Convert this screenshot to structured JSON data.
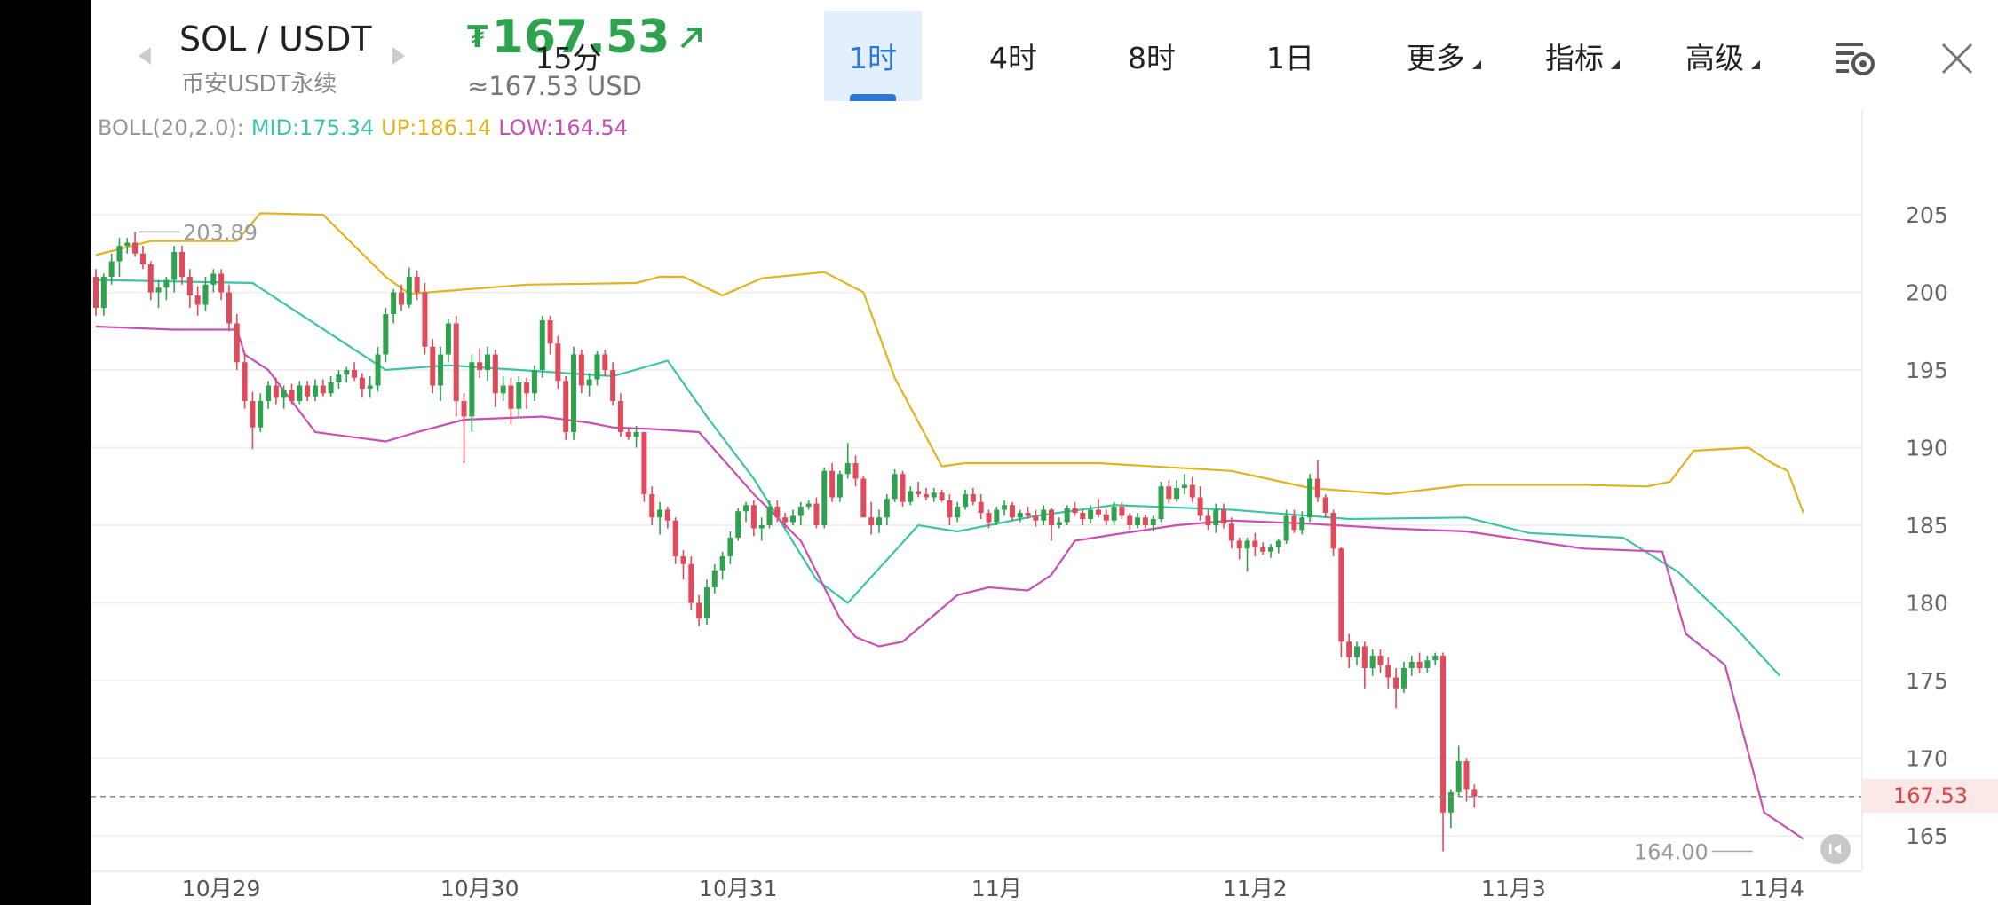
{
  "header": {
    "symbol": "SOL / USDT",
    "market": "币安USDT永续",
    "price": "167.53",
    "currency_symbol": "₮",
    "approx": "≈167.53 USD",
    "intervals": [
      {
        "label": "15分"
      },
      {
        "label": "1时"
      },
      {
        "label": "4时"
      },
      {
        "label": "8时"
      },
      {
        "label": "1日"
      }
    ],
    "active_interval": "1时",
    "menus": [
      {
        "label": "更多"
      },
      {
        "label": "指标"
      },
      {
        "label": "高级"
      }
    ],
    "settings_icon": "chart-settings-icon",
    "close_icon": "close-icon"
  },
  "indicator": {
    "name": "BOLL(20,2.0):",
    "mid": "MID:175.34",
    "up": "UP:186.14",
    "low": "LOW:164.54"
  },
  "colors": {
    "up": "#2ea24e",
    "down": "#e04a5a",
    "mid": "#3cc4a4",
    "upper": "#e0b420",
    "lower": "#c84fb4",
    "accent": "#2a78dc"
  },
  "chart_data": {
    "type": "candlestick",
    "ylim": [
      162,
      209
    ],
    "yticks": [
      205,
      200,
      195,
      190,
      185,
      180,
      175,
      170,
      165
    ],
    "x_labels": [
      {
        "label": "10月29",
        "index": 16
      },
      {
        "label": "10月30",
        "index": 49
      },
      {
        "label": "10月31",
        "index": 82
      },
      {
        "label": "11月",
        "index": 115
      },
      {
        "label": "11月2",
        "index": 148
      },
      {
        "label": "11月3",
        "index": 181
      },
      {
        "label": "11月4",
        "index": 214
      }
    ],
    "last_price": 167.53,
    "last_price_label": "167.53",
    "max_label": "203.89",
    "max_value": 203.89,
    "max_index": 5,
    "min_label": "164.00",
    "min_value": 164.0,
    "min_index": 212,
    "boll_mid": [
      [
        0,
        200.8
      ],
      [
        20,
        200.6
      ],
      [
        37,
        195.0
      ],
      [
        45,
        195.3
      ],
      [
        66,
        194.6
      ],
      [
        73,
        195.6
      ],
      [
        78,
        192.0
      ],
      [
        84,
        188.0
      ],
      [
        92,
        181.5
      ],
      [
        96,
        180.0
      ],
      [
        105,
        185.0
      ],
      [
        110,
        184.6
      ],
      [
        120,
        185.6
      ],
      [
        130,
        186.3
      ],
      [
        145,
        186.0
      ],
      [
        160,
        185.4
      ],
      [
        175,
        185.5
      ],
      [
        183,
        184.5
      ],
      [
        195,
        184.2
      ],
      [
        202,
        182.0
      ],
      [
        209,
        178.6
      ],
      [
        215,
        175.3
      ]
    ],
    "boll_upper": [
      [
        0,
        202.4
      ],
      [
        7,
        203.3
      ],
      [
        18,
        203.3
      ],
      [
        21,
        205.1
      ],
      [
        29,
        205.0
      ],
      [
        37,
        201.0
      ],
      [
        40,
        199.9
      ],
      [
        55,
        200.5
      ],
      [
        69,
        200.6
      ],
      [
        72,
        201.0
      ],
      [
        75,
        201.0
      ],
      [
        80,
        199.8
      ],
      [
        85,
        200.9
      ],
      [
        93,
        201.3
      ],
      [
        98,
        200.0
      ],
      [
        102,
        194.5
      ],
      [
        108,
        188.8
      ],
      [
        111,
        189.0
      ],
      [
        128,
        189.0
      ],
      [
        145,
        188.5
      ],
      [
        155,
        187.4
      ],
      [
        165,
        187.0
      ],
      [
        175,
        187.6
      ],
      [
        190,
        187.6
      ],
      [
        198,
        187.5
      ],
      [
        201,
        187.8
      ],
      [
        204,
        189.8
      ],
      [
        211,
        190.0
      ],
      [
        214,
        189.0
      ],
      [
        216,
        188.5
      ],
      [
        218,
        185.8
      ]
    ],
    "boll_lower": [
      [
        0,
        197.8
      ],
      [
        10,
        197.6
      ],
      [
        18,
        197.6
      ],
      [
        19,
        196.0
      ],
      [
        22,
        195.0
      ],
      [
        28,
        191.0
      ],
      [
        37,
        190.4
      ],
      [
        41,
        191.0
      ],
      [
        47,
        191.8
      ],
      [
        57,
        192.0
      ],
      [
        63,
        191.6
      ],
      [
        66,
        191.3
      ],
      [
        71,
        191.2
      ],
      [
        77,
        191.0
      ],
      [
        84,
        187.0
      ],
      [
        90,
        184.0
      ],
      [
        95,
        179.0
      ],
      [
        97,
        177.8
      ],
      [
        100,
        177.2
      ],
      [
        103,
        177.5
      ],
      [
        110,
        180.5
      ],
      [
        114,
        181.0
      ],
      [
        119,
        180.8
      ],
      [
        122,
        181.8
      ],
      [
        125,
        184.0
      ],
      [
        130,
        184.4
      ],
      [
        138,
        185.0
      ],
      [
        145,
        185.3
      ],
      [
        155,
        185.1
      ],
      [
        165,
        184.8
      ],
      [
        175,
        184.6
      ],
      [
        190,
        183.5
      ],
      [
        200,
        183.3
      ],
      [
        203,
        178.0
      ],
      [
        208,
        176.0
      ],
      [
        213,
        166.5
      ],
      [
        218,
        164.8
      ]
    ],
    "candles": [
      [
        201.0,
        201.5,
        198.5,
        199.0
      ],
      [
        199.0,
        201.2,
        198.5,
        201.0
      ],
      [
        201.0,
        202.5,
        200.5,
        202.0
      ],
      [
        202.0,
        203.5,
        201.0,
        203.0
      ],
      [
        203.0,
        203.5,
        202.5,
        203.2
      ],
      [
        203.2,
        203.89,
        202.3,
        202.5
      ],
      [
        202.5,
        203.0,
        201.5,
        201.8
      ],
      [
        201.8,
        202.0,
        199.5,
        200.0
      ],
      [
        200.0,
        200.8,
        199.0,
        200.3
      ],
      [
        200.3,
        201.0,
        199.5,
        200.8
      ],
      [
        200.8,
        203.0,
        200.0,
        202.6
      ],
      [
        202.6,
        203.0,
        200.5,
        201.0
      ],
      [
        201.0,
        201.5,
        199.0,
        199.8
      ],
      [
        199.8,
        200.4,
        198.5,
        199.2
      ],
      [
        199.2,
        201.0,
        198.8,
        200.5
      ],
      [
        200.5,
        201.5,
        200.0,
        201.2
      ],
      [
        201.2,
        201.5,
        199.5,
        200.0
      ],
      [
        200.0,
        200.5,
        197.5,
        198.0
      ],
      [
        198.0,
        198.6,
        195.0,
        195.5
      ],
      [
        195.5,
        196.0,
        192.5,
        193.0
      ],
      [
        193.0,
        193.6,
        189.9,
        191.3
      ],
      [
        191.3,
        193.5,
        191.0,
        193.0
      ],
      [
        193.0,
        194.3,
        192.5,
        194.0
      ],
      [
        194.0,
        194.5,
        192.8,
        193.2
      ],
      [
        193.2,
        194.0,
        192.5,
        193.7
      ],
      [
        193.7,
        194.1,
        192.8,
        193.0
      ],
      [
        193.0,
        194.3,
        192.8,
        194.0
      ],
      [
        194.0,
        194.3,
        193.0,
        193.3
      ],
      [
        193.3,
        194.4,
        193.0,
        194.0
      ],
      [
        194.0,
        194.4,
        193.3,
        193.5
      ],
      [
        193.5,
        194.6,
        193.3,
        194.2
      ],
      [
        194.2,
        195.0,
        193.8,
        194.7
      ],
      [
        194.7,
        195.2,
        194.2,
        195.0
      ],
      [
        195.0,
        195.5,
        194.3,
        194.5
      ],
      [
        194.5,
        194.8,
        193.2,
        193.8
      ],
      [
        193.8,
        194.6,
        193.2,
        194.0
      ],
      [
        194.0,
        196.5,
        193.6,
        196.0
      ],
      [
        196.0,
        199.0,
        195.5,
        198.6
      ],
      [
        198.6,
        200.2,
        198.0,
        200.0
      ],
      [
        200.0,
        200.5,
        198.8,
        199.2
      ],
      [
        199.2,
        201.6,
        199.0,
        201.0
      ],
      [
        201.0,
        201.4,
        199.5,
        200.0
      ],
      [
        200.0,
        200.6,
        196.0,
        196.5
      ],
      [
        196.5,
        197.0,
        193.5,
        194.0
      ],
      [
        194.0,
        196.5,
        193.0,
        196.0
      ],
      [
        196.0,
        198.3,
        195.5,
        198.0
      ],
      [
        198.0,
        198.5,
        192.0,
        193.0
      ],
      [
        193.0,
        193.5,
        189.0,
        192.0
      ],
      [
        192.0,
        196.0,
        191.0,
        195.5
      ],
      [
        195.5,
        196.4,
        194.5,
        195.0
      ],
      [
        195.0,
        196.5,
        194.3,
        196.0
      ],
      [
        196.0,
        196.3,
        192.6,
        193.5
      ],
      [
        193.5,
        194.6,
        193.0,
        194.0
      ],
      [
        194.0,
        194.5,
        191.5,
        192.5
      ],
      [
        192.5,
        194.6,
        192.0,
        194.2
      ],
      [
        194.2,
        194.5,
        192.5,
        193.5
      ],
      [
        193.5,
        195.3,
        193.0,
        195.0
      ],
      [
        195.0,
        198.5,
        194.5,
        198.2
      ],
      [
        198.2,
        198.5,
        196.0,
        196.7
      ],
      [
        196.7,
        197.2,
        193.8,
        194.3
      ],
      [
        194.3,
        194.6,
        190.5,
        191.0
      ],
      [
        191.0,
        196.5,
        190.5,
        196.0
      ],
      [
        196.0,
        196.3,
        193.5,
        194.0
      ],
      [
        194.0,
        194.8,
        193.3,
        194.4
      ],
      [
        194.4,
        196.2,
        194.0,
        196.0
      ],
      [
        196.0,
        196.3,
        194.6,
        195.0
      ],
      [
        195.0,
        195.5,
        192.7,
        193.0
      ],
      [
        193.0,
        193.5,
        190.7,
        191.0
      ],
      [
        191.0,
        191.2,
        190.5,
        190.7
      ],
      [
        190.7,
        191.4,
        190.0,
        191.0
      ],
      [
        191.0,
        191.0,
        186.5,
        187.0
      ],
      [
        187.0,
        187.5,
        185.0,
        185.5
      ],
      [
        185.5,
        186.5,
        184.4,
        186.0
      ],
      [
        186.0,
        186.2,
        184.8,
        185.3
      ],
      [
        185.3,
        185.5,
        182.5,
        183.0
      ],
      [
        183.0,
        183.4,
        181.5,
        182.5
      ],
      [
        182.5,
        183.0,
        179.5,
        180.0
      ],
      [
        180.0,
        180.5,
        178.5,
        179.0
      ],
      [
        179.0,
        181.5,
        178.6,
        181.0
      ],
      [
        181.0,
        182.5,
        180.6,
        182.1
      ],
      [
        182.1,
        183.3,
        181.5,
        183.0
      ],
      [
        183.0,
        184.6,
        182.5,
        184.2
      ],
      [
        184.2,
        186.1,
        184.0,
        185.9
      ],
      [
        185.9,
        186.5,
        185.2,
        186.3
      ],
      [
        186.3,
        186.6,
        184.3,
        184.8
      ],
      [
        184.8,
        185.5,
        184.0,
        185.0
      ],
      [
        185.0,
        186.6,
        184.8,
        186.2
      ],
      [
        186.2,
        186.6,
        185.2,
        185.5
      ],
      [
        185.5,
        185.8,
        184.8,
        185.2
      ],
      [
        185.2,
        186.0,
        185.0,
        185.6
      ],
      [
        185.6,
        186.5,
        185.0,
        186.2
      ],
      [
        186.2,
        186.6,
        186.0,
        186.4
      ],
      [
        186.4,
        186.8,
        184.8,
        185.0
      ],
      [
        185.0,
        188.7,
        184.8,
        188.5
      ],
      [
        188.5,
        189.0,
        186.5,
        186.8
      ],
      [
        186.8,
        188.5,
        186.5,
        188.3
      ],
      [
        188.3,
        190.3,
        188.0,
        189.0
      ],
      [
        189.0,
        189.5,
        187.5,
        188.0
      ],
      [
        188.0,
        188.2,
        185.5,
        185.5
      ],
      [
        185.5,
        186.5,
        184.4,
        185.0
      ],
      [
        185.0,
        186.0,
        184.5,
        185.5
      ],
      [
        185.5,
        187.0,
        185.0,
        186.7
      ],
      [
        186.7,
        188.6,
        186.5,
        188.3
      ],
      [
        188.3,
        188.5,
        186.2,
        186.5
      ],
      [
        186.5,
        187.5,
        186.3,
        187.2
      ],
      [
        187.2,
        187.8,
        186.8,
        187.0
      ],
      [
        187.0,
        187.4,
        186.6,
        186.8
      ],
      [
        186.8,
        187.4,
        186.5,
        187.1
      ],
      [
        187.1,
        187.3,
        186.5,
        186.6
      ],
      [
        186.6,
        187.0,
        185.0,
        185.5
      ],
      [
        185.5,
        186.5,
        185.2,
        186.2
      ],
      [
        186.2,
        187.3,
        186.0,
        187.0
      ],
      [
        187.0,
        187.4,
        186.3,
        186.5
      ],
      [
        186.5,
        187.0,
        185.4,
        185.8
      ],
      [
        185.8,
        186.0,
        184.8,
        185.2
      ],
      [
        185.2,
        186.2,
        185.0,
        186.0
      ],
      [
        186.0,
        186.6,
        185.6,
        186.3
      ],
      [
        186.3,
        186.5,
        185.3,
        185.5
      ],
      [
        185.5,
        186.0,
        185.2,
        185.8
      ],
      [
        185.8,
        186.2,
        185.4,
        185.6
      ],
      [
        185.6,
        186.0,
        184.9,
        185.3
      ],
      [
        185.3,
        186.3,
        185.0,
        186.0
      ],
      [
        186.0,
        186.1,
        184.0,
        185.0
      ],
      [
        185.0,
        185.5,
        184.8,
        185.2
      ],
      [
        185.2,
        186.3,
        185.0,
        186.1
      ],
      [
        186.1,
        186.5,
        185.6,
        185.8
      ],
      [
        185.8,
        186.0,
        185.0,
        185.4
      ],
      [
        185.4,
        186.3,
        185.1,
        186.0
      ],
      [
        186.0,
        186.7,
        185.5,
        185.7
      ],
      [
        185.7,
        186.0,
        185.0,
        185.3
      ],
      [
        185.3,
        186.5,
        185.0,
        186.2
      ],
      [
        186.2,
        186.5,
        185.4,
        185.6
      ],
      [
        185.6,
        185.8,
        184.7,
        185.0
      ],
      [
        185.0,
        185.8,
        184.8,
        185.5
      ],
      [
        185.5,
        185.7,
        184.8,
        185.0
      ],
      [
        185.0,
        185.6,
        184.6,
        185.4
      ],
      [
        185.4,
        187.8,
        185.2,
        187.5
      ],
      [
        187.5,
        187.9,
        186.4,
        186.7
      ],
      [
        186.7,
        187.9,
        186.5,
        187.4
      ],
      [
        187.4,
        188.3,
        187.0,
        187.6
      ],
      [
        187.6,
        188.1,
        186.5,
        186.8
      ],
      [
        186.8,
        187.5,
        185.3,
        185.6
      ],
      [
        185.6,
        186.0,
        184.7,
        185.0
      ],
      [
        185.0,
        186.4,
        184.5,
        186.0
      ],
      [
        186.0,
        186.4,
        184.8,
        185.1
      ],
      [
        185.1,
        185.5,
        183.5,
        184.0
      ],
      [
        184.0,
        184.2,
        182.8,
        183.5
      ],
      [
        183.5,
        184.2,
        182.0,
        184.0
      ],
      [
        184.0,
        184.5,
        183.0,
        183.6
      ],
      [
        183.6,
        183.9,
        183.1,
        183.3
      ],
      [
        183.3,
        183.8,
        182.9,
        183.6
      ],
      [
        183.6,
        184.1,
        183.2,
        184.0
      ],
      [
        184.0,
        186.0,
        183.8,
        185.6
      ],
      [
        185.6,
        186.0,
        184.5,
        184.7
      ],
      [
        184.7,
        185.9,
        184.4,
        185.5
      ],
      [
        185.5,
        188.3,
        185.2,
        188.0
      ],
      [
        188.0,
        189.2,
        186.5,
        186.8
      ],
      [
        186.8,
        187.0,
        185.5,
        185.8
      ],
      [
        185.8,
        186.0,
        183.0,
        183.5
      ],
      [
        183.5,
        183.6,
        176.5,
        177.5
      ],
      [
        177.5,
        178.0,
        175.8,
        176.5
      ],
      [
        176.5,
        177.5,
        176.0,
        177.2
      ],
      [
        177.2,
        177.5,
        174.5,
        175.8
      ],
      [
        175.8,
        177.0,
        175.3,
        176.6
      ],
      [
        176.6,
        177.0,
        175.5,
        176.0
      ],
      [
        176.0,
        176.5,
        174.5,
        175.2
      ],
      [
        175.2,
        175.8,
        173.2,
        174.5
      ],
      [
        174.5,
        176.2,
        174.2,
        175.8
      ],
      [
        175.8,
        176.6,
        175.3,
        176.2
      ],
      [
        176.2,
        176.8,
        175.5,
        175.8
      ],
      [
        175.8,
        176.6,
        175.5,
        176.3
      ],
      [
        176.3,
        176.8,
        176.0,
        176.6
      ],
      [
        176.6,
        176.8,
        164.0,
        166.5
      ],
      [
        166.5,
        168.0,
        165.5,
        167.8
      ],
      [
        167.8,
        170.8,
        167.5,
        169.8
      ],
      [
        169.8,
        170.0,
        167.2,
        168.0
      ],
      [
        168.0,
        168.3,
        166.8,
        167.53
      ]
    ]
  }
}
